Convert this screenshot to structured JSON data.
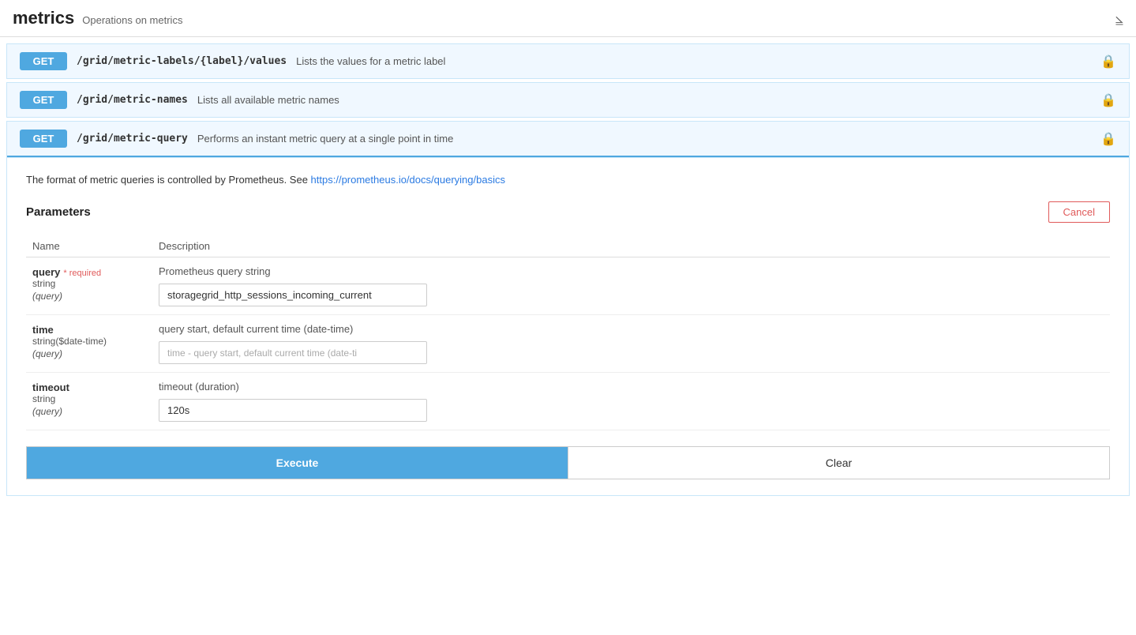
{
  "header": {
    "title": "metrics",
    "subtitle": "Operations on metrics"
  },
  "endpoints": [
    {
      "id": "metric-labels",
      "method": "GET",
      "path": "/grid/metric-labels/{label}/values",
      "description": "Lists the values for a metric label"
    },
    {
      "id": "metric-names",
      "method": "GET",
      "path": "/grid/metric-names",
      "description": "Lists all available metric names"
    },
    {
      "id": "metric-query",
      "method": "GET",
      "path": "/grid/metric-query",
      "description": "Performs an instant metric query at a single point in time",
      "expanded": true
    }
  ],
  "expanded": {
    "prometheus_note": "The format of metric queries is controlled by Prometheus. See ",
    "prometheus_link_text": "https://prometheus.io/docs/querying/basics",
    "prometheus_link_href": "https://prometheus.io/docs/querying/basics",
    "params_title": "Parameters",
    "cancel_label": "Cancel",
    "columns": {
      "name": "Name",
      "description": "Description"
    },
    "parameters": [
      {
        "name": "query",
        "required": true,
        "required_label": "* required",
        "type": "string",
        "context": "(query)",
        "description": "Prometheus query string",
        "value": "storagegrid_http_sessions_incoming_current",
        "placeholder": ""
      },
      {
        "name": "time",
        "required": false,
        "type": "string($date-time)",
        "context": "(query)",
        "description": "query start, default current time (date-time)",
        "value": "",
        "placeholder": "time - query start, default current time (date-ti"
      },
      {
        "name": "timeout",
        "required": false,
        "type": "string",
        "context": "(query)",
        "description": "timeout (duration)",
        "value": "120s",
        "placeholder": ""
      }
    ],
    "execute_label": "Execute",
    "clear_label": "Clear"
  }
}
